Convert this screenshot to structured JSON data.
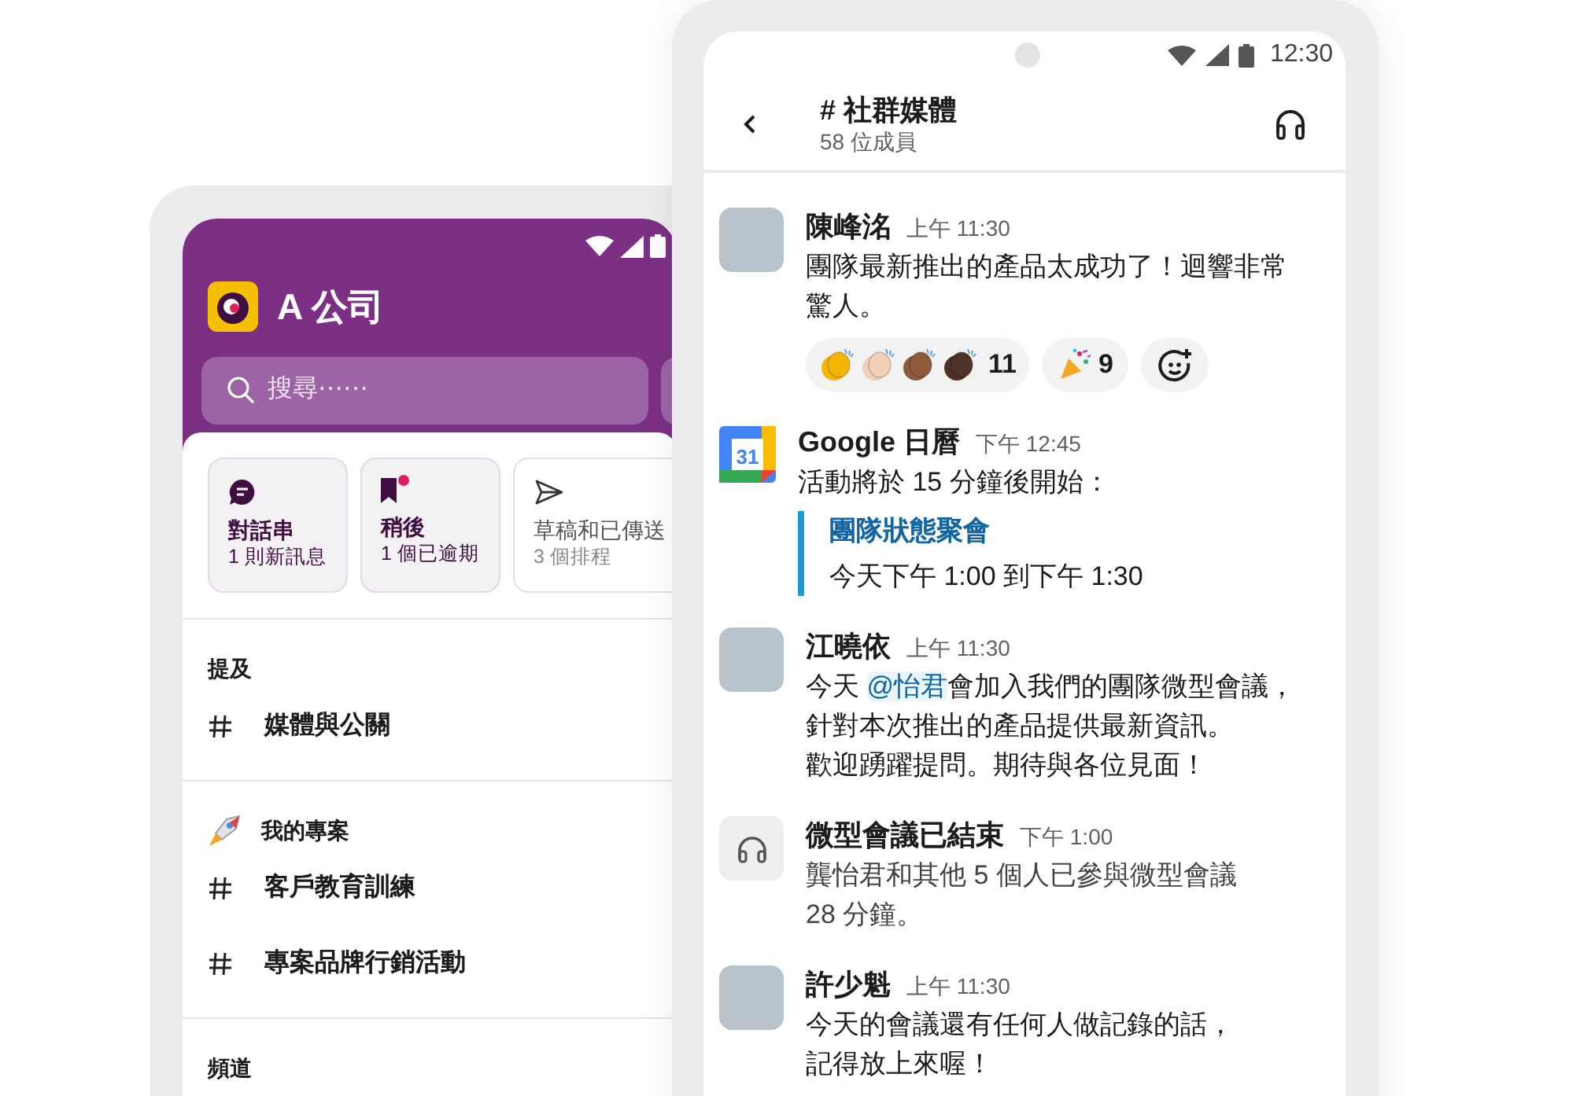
{
  "left_phone": {
    "workspace": {
      "name": "A 公司"
    },
    "search": {
      "placeholder": "搜尋⋯⋯"
    },
    "cards": [
      {
        "kind": "threads",
        "title": "對話串",
        "subtitle": "1 則新訊息",
        "highlighted": true,
        "unread_dot": false
      },
      {
        "kind": "later",
        "title": "稍後",
        "subtitle": "1 個已逾期",
        "highlighted": true,
        "unread_dot": true
      },
      {
        "kind": "drafts",
        "title": "草稿和已傳送",
        "subtitle": "3 個排程",
        "highlighted": false,
        "unread_dot": false
      }
    ],
    "sections": [
      {
        "header": {
          "kind": "plain",
          "label": "提及"
        },
        "items": [
          {
            "label": "媒體與公關"
          }
        ]
      },
      {
        "header": {
          "kind": "rocket",
          "label": "我的專案"
        },
        "items": [
          {
            "label": "客戶教育訓練"
          },
          {
            "label": "專案品牌行銷活動"
          }
        ]
      },
      {
        "header": {
          "kind": "plain",
          "label": "頻道"
        }
      }
    ]
  },
  "right_phone": {
    "status_bar": {
      "time": "12:30"
    },
    "channel": {
      "name": "# 社群媒體",
      "members": "58 位成員"
    },
    "messages": [
      {
        "kind": "message",
        "name": "陳峰洺",
        "time": "上午 11:30",
        "lines": [
          "團隊最新推出的產品太成功了！迴響非常",
          "驚人。"
        ],
        "reactions": [
          {
            "kind": "clap",
            "count": "11"
          },
          {
            "kind": "party",
            "count": "9"
          },
          {
            "kind": "add"
          }
        ]
      },
      {
        "kind": "calendar",
        "icon_text": "31",
        "name": "Google 日曆",
        "time": "下午 12:45",
        "lines": [
          "活動將於 15 分鐘後開始："
        ],
        "event_title": "團隊狀態聚會",
        "event_time": "今天下午 1:00 到下午 1:30"
      },
      {
        "kind": "mention",
        "name": "江曉依",
        "time": "上午 11:30",
        "text_before": "今天 ",
        "mention": "@怡君",
        "text_after": "會加入我們的團隊微型會議，",
        "lines": [
          "針對本次推出的產品提供最新資訊。",
          "歡迎踴躍提問。期待與各位見面！"
        ]
      },
      {
        "kind": "huddle",
        "name": "微型會議已結束",
        "time": "下午 1:00",
        "lines": [
          "龔怡君和其他 5 個人已參與微型會議",
          "28 分鐘。"
        ]
      },
      {
        "kind": "message",
        "name": "許少魁",
        "time": "上午 11:30",
        "lines": [
          "今天的會議還有任何人做記錄的話，",
          "記得放上來喔！"
        ]
      }
    ]
  }
}
